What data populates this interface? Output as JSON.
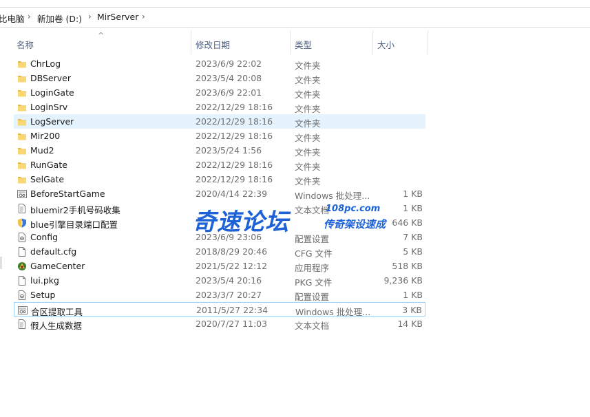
{
  "breadcrumb": {
    "items": [
      "比电脑",
      "新加卷 (D:)",
      "MirServer"
    ],
    "separator": "›"
  },
  "columns": {
    "name": "名称",
    "date": "修改日期",
    "type": "类型",
    "size": "大小",
    "sort_indicator": "^"
  },
  "files": [
    {
      "name": "ChrLog",
      "date": "2023/6/9 22:02",
      "type": "文件夹",
      "size": "",
      "icon": "folder-icon"
    },
    {
      "name": "DBServer",
      "date": "2023/5/4 20:08",
      "type": "文件夹",
      "size": "",
      "icon": "folder-icon"
    },
    {
      "name": "LoginGate",
      "date": "2023/6/9 22:01",
      "type": "文件夹",
      "size": "",
      "icon": "folder-icon"
    },
    {
      "name": "LoginSrv",
      "date": "2022/12/29 18:16",
      "type": "文件夹",
      "size": "",
      "icon": "folder-icon"
    },
    {
      "name": "LogServer",
      "date": "2022/12/29 18:16",
      "type": "文件夹",
      "size": "",
      "icon": "folder-icon"
    },
    {
      "name": "Mir200",
      "date": "2022/12/29 18:16",
      "type": "文件夹",
      "size": "",
      "icon": "folder-icon"
    },
    {
      "name": "Mud2",
      "date": "2023/5/24 1:56",
      "type": "文件夹",
      "size": "",
      "icon": "folder-icon"
    },
    {
      "name": "RunGate",
      "date": "2022/12/29 18:16",
      "type": "文件夹",
      "size": "",
      "icon": "folder-icon"
    },
    {
      "name": "SelGate",
      "date": "2022/12/29 18:16",
      "type": "文件夹",
      "size": "",
      "icon": "folder-icon"
    },
    {
      "name": "BeforeStartGame",
      "date": "2020/4/14 22:39",
      "type": "Windows 批处理...",
      "size": "1 KB",
      "icon": "batch-file-icon"
    },
    {
      "name": "bluemir2手机号码收集",
      "date": "",
      "type": "文本文档",
      "size": "1 KB",
      "icon": "text-file-icon"
    },
    {
      "name": "blue引擎目录端口配置",
      "date": "",
      "type": "",
      "size": "646 KB",
      "icon": "shield-app-icon"
    },
    {
      "name": "Config",
      "date": "2023/6/9 23:06",
      "type": "配置设置",
      "size": "7 KB",
      "icon": "config-file-icon"
    },
    {
      "name": "default.cfg",
      "date": "2018/8/29 20:46",
      "type": "CFG 文件",
      "size": "5 KB",
      "icon": "blank-file-icon"
    },
    {
      "name": "GameCenter",
      "date": "2021/5/22 12:12",
      "type": "应用程序",
      "size": "518 KB",
      "icon": "app-icon"
    },
    {
      "name": "lui.pkg",
      "date": "2023/5/4 20:16",
      "type": "PKG 文件",
      "size": "9,236 KB",
      "icon": "blank-file-icon"
    },
    {
      "name": "Setup",
      "date": "2023/3/7 20:27",
      "type": "配置设置",
      "size": "1 KB",
      "icon": "config-file-icon"
    },
    {
      "name": "合区提取工具",
      "date": "2011/5/27 22:34",
      "type": "Windows 批处理...",
      "size": "3 KB",
      "icon": "batch-file-icon"
    },
    {
      "name": "假人生成数据",
      "date": "2020/7/27 11:03",
      "type": "文本文档",
      "size": "14 KB",
      "icon": "text-file-icon"
    }
  ],
  "watermark": {
    "main": "奇速论坛",
    "url": "108pc.com",
    "slogan": "传奇架设速成"
  },
  "colors": {
    "hover_bg": "#e5f3ff",
    "selected_border": "#99d1ff",
    "folder_yellow": "#f8d775",
    "watermark_blue": "#1d62d6"
  }
}
